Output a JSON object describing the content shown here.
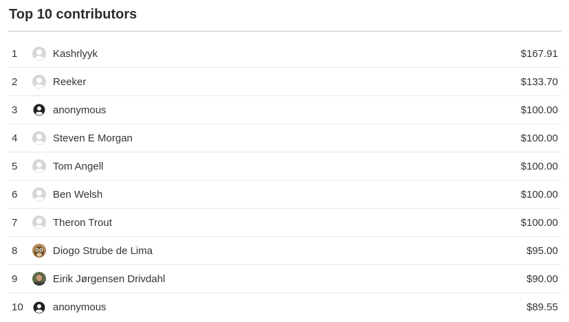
{
  "title": "Top 10 contributors",
  "contributors": [
    {
      "rank": "1",
      "name": "Kashrlyyk",
      "amount": "$167.91",
      "avatar": "default-avatar-icon"
    },
    {
      "rank": "2",
      "name": "Reeker",
      "amount": "$133.70",
      "avatar": "default-avatar-icon"
    },
    {
      "rank": "3",
      "name": "anonymous",
      "amount": "$100.00",
      "avatar": "anonymous-user-icon"
    },
    {
      "rank": "4",
      "name": "Steven E Morgan",
      "amount": "$100.00",
      "avatar": "default-avatar-icon"
    },
    {
      "rank": "5",
      "name": "Tom Angell",
      "amount": "$100.00",
      "avatar": "default-avatar-icon"
    },
    {
      "rank": "6",
      "name": "Ben Welsh",
      "amount": "$100.00",
      "avatar": "default-avatar-icon"
    },
    {
      "rank": "7",
      "name": "Theron Trout",
      "amount": "$100.00",
      "avatar": "default-avatar-icon"
    },
    {
      "rank": "8",
      "name": "Diogo Strube de Lima",
      "amount": "$95.00",
      "avatar": "owl-photo-avatar"
    },
    {
      "rank": "9",
      "name": "Eirik Jørgensen Drivdahl",
      "amount": "$90.00",
      "avatar": "person-photo-avatar"
    },
    {
      "rank": "10",
      "name": "anonymous",
      "amount": "$89.55",
      "avatar": "anonymous-user-icon"
    }
  ],
  "colors": {
    "text": "#333333",
    "divider": "#e6e6e6",
    "header_rule": "#c4c4c4",
    "default_avatar": "#d6d6d6",
    "anonymous_icon": "#222222"
  }
}
